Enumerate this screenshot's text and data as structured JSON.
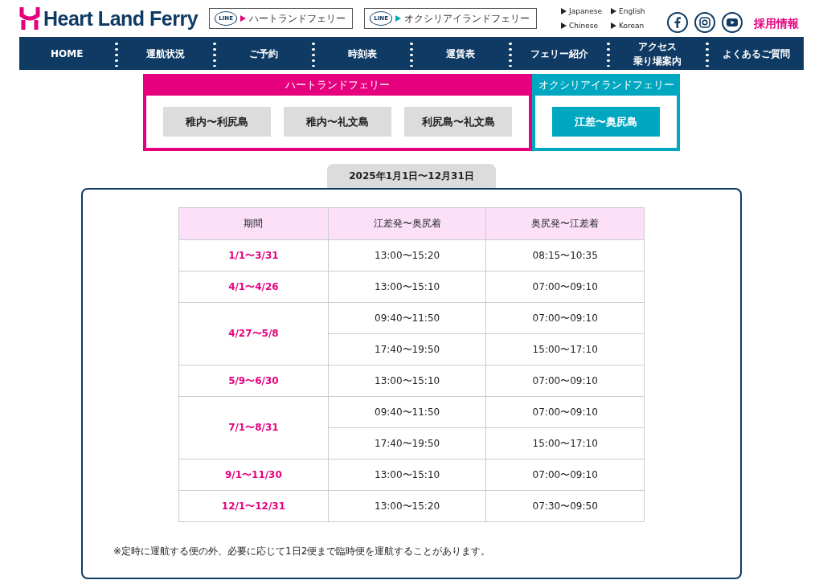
{
  "logo": {
    "text": "Heart Land Ferry"
  },
  "line_links": [
    {
      "label": "LINE",
      "text": "ハートランドフェリー",
      "color": "#e6007e"
    },
    {
      "label": "LINE",
      "text": "オクシリアイランドフェリー",
      "color": "#00a7c0"
    }
  ],
  "languages": [
    "Japanese",
    "English",
    "Chinese",
    "Korean"
  ],
  "recruit": "採用情報",
  "nav": [
    [
      "HOME"
    ],
    [
      "運航状況"
    ],
    [
      "ご予約"
    ],
    [
      "時刻表"
    ],
    [
      "運賃表"
    ],
    [
      "フェリー紹介"
    ],
    [
      "アクセス",
      "乗り場案内"
    ],
    [
      "よくあるご質問"
    ]
  ],
  "route_groups": [
    {
      "title": "ハートランドフェリー",
      "color": "#e6007e",
      "routes": [
        {
          "label": "稚内〜利尻島",
          "selected": false
        },
        {
          "label": "稚内〜礼文島",
          "selected": false
        },
        {
          "label": "利尻島〜礼文島",
          "selected": false
        }
      ]
    },
    {
      "title": "オクシリアイランドフェリー",
      "color": "#00a7c0",
      "routes": [
        {
          "label": "江差〜奥尻島",
          "selected": true
        }
      ]
    }
  ],
  "period_tab": "2025年1月1日〜12月31日",
  "table": {
    "columns": [
      "期間",
      "江差発〜奥尻着",
      "奥尻発〜江差着"
    ],
    "rows": [
      {
        "period": "1/1〜3/31",
        "times": [
          [
            "13:00〜15:20",
            "08:15〜10:35"
          ]
        ]
      },
      {
        "period": "4/1〜4/26",
        "times": [
          [
            "13:00〜15:10",
            "07:00〜09:10"
          ]
        ]
      },
      {
        "period": "4/27〜5/8",
        "times": [
          [
            "09:40〜11:50",
            "07:00〜09:10"
          ],
          [
            "17:40〜19:50",
            "15:00〜17:10"
          ]
        ]
      },
      {
        "period": "5/9〜6/30",
        "times": [
          [
            "13:00〜15:10",
            "07:00〜09:10"
          ]
        ]
      },
      {
        "period": "7/1〜8/31",
        "times": [
          [
            "09:40〜11:50",
            "07:00〜09:10"
          ],
          [
            "17:40〜19:50",
            "15:00〜17:10"
          ]
        ]
      },
      {
        "period": "9/1〜11/30",
        "times": [
          [
            "13:00〜15:10",
            "07:00〜09:10"
          ]
        ]
      },
      {
        "period": "12/1〜12/31",
        "times": [
          [
            "13:00〜15:20",
            "07:30〜09:50"
          ]
        ]
      }
    ]
  },
  "note": "※定時に運航する便の外、必要に応じて1日2便まで臨時便を運航することがあります。"
}
